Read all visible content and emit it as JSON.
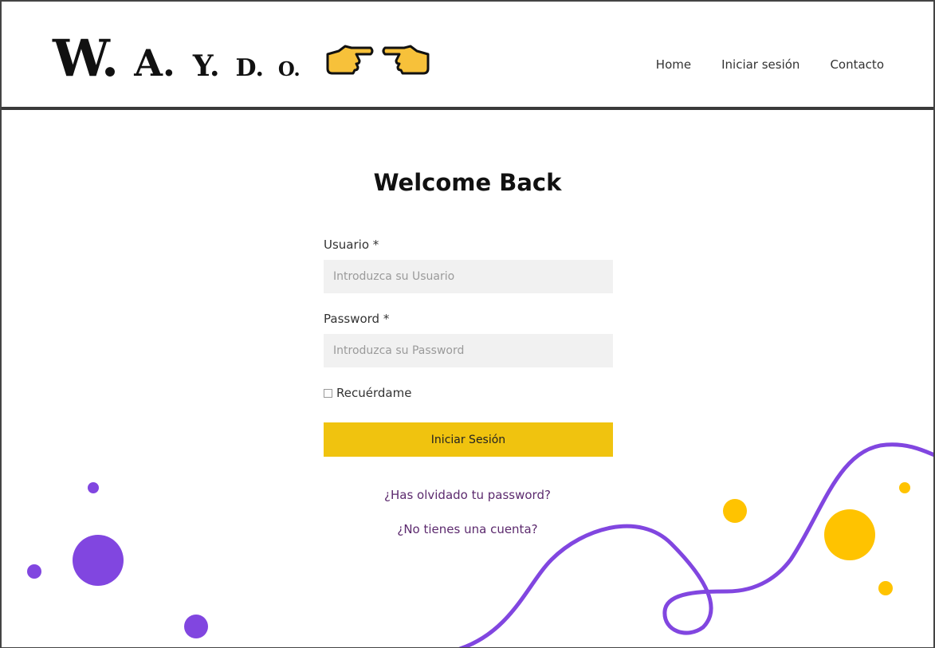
{
  "brand": {
    "letters": [
      "W.",
      "A.",
      "Y.",
      "D.",
      "O."
    ]
  },
  "nav": {
    "items": [
      "Home",
      "Iniciar sesión",
      "Contacto"
    ]
  },
  "login": {
    "title": "Welcome Back",
    "username_label": "Usuario *",
    "username_placeholder": "Introduzca su Usuario",
    "password_label": "Password *",
    "password_placeholder": "Introduzca su Password",
    "remember_label": "Recuérdame",
    "submit_label": "Iniciar Sesión",
    "forgot_link": "¿Has olvidado tu password?",
    "signup_link": "¿No tienes una cuenta?"
  },
  "colors": {
    "accent_yellow": "#f0c30f",
    "link_purple": "#5c2a6e",
    "decor_purple": "#8146e0",
    "decor_yellow": "#ffc300"
  }
}
